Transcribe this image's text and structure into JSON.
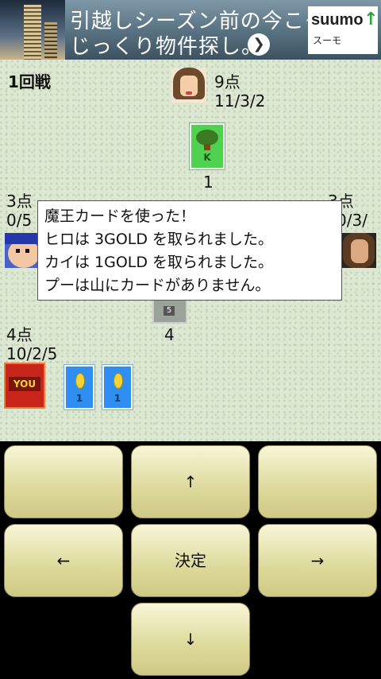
{
  "ad": {
    "line1": "引越しシーズン前の今こそ",
    "line2": "じっくり物件探し。",
    "arrow": "❯",
    "brand": "suumo",
    "brand_sub": "スーモ",
    "brand_mark": "↑"
  },
  "game": {
    "round": "1回戦",
    "top_player": {
      "score": "9点",
      "stats": "11/3/2"
    },
    "left_player": {
      "score": "3点",
      "stats": "0/5"
    },
    "right_player": {
      "score": "3点",
      "stats": "0/3/"
    },
    "self_player": {
      "score": "4点",
      "stats": "10/2/5"
    },
    "top_card_label": "K",
    "top_card_count": "1",
    "center_card_label": "5",
    "center_card_count": "4",
    "you_card_label": "YOU",
    "hand_cards": [
      "1",
      "1"
    ]
  },
  "dialog": {
    "lines": [
      "魔王カードを使った！",
      "ヒロは 3GOLD を取られました。",
      "カイは 1GOLD を取られました。",
      "プーは山にカードがありません。"
    ]
  },
  "controls": {
    "up": "↑",
    "left": "←",
    "confirm": "決定",
    "right": "→",
    "down": "↓",
    "blank": ""
  },
  "colors": {
    "board_bg": "#dde8d2",
    "button_face": "#e8e5b4",
    "you_card": "#c8261a",
    "coin_card": "#2f8ff0",
    "green_card": "#4fd24f"
  }
}
